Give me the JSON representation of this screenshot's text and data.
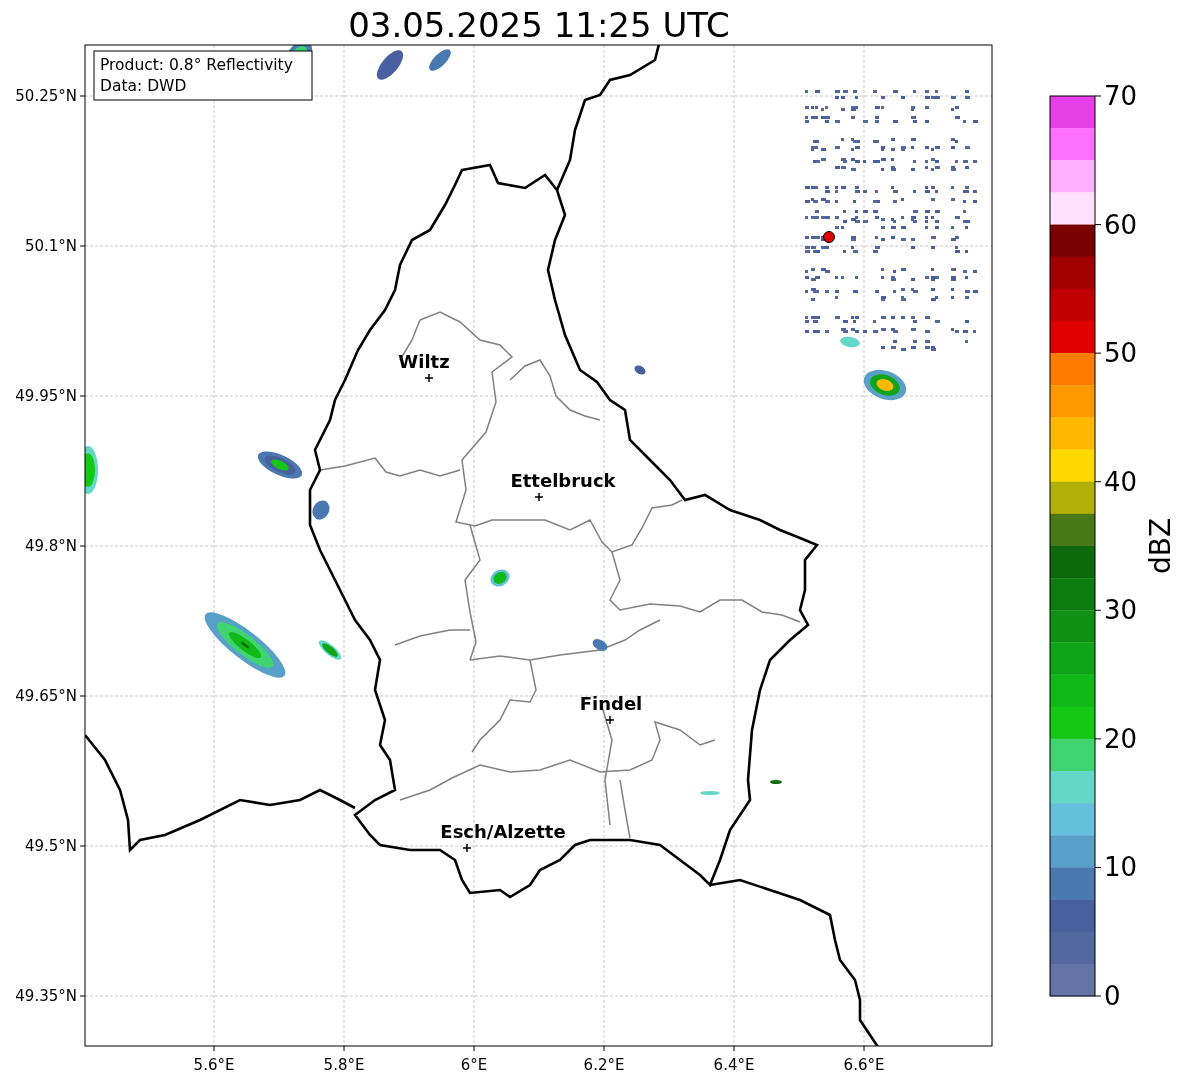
{
  "title": "03.05.2025 11:25 UTC",
  "info_box": [
    "Product: 0.8° Reflectivity",
    "Data: DWD"
  ],
  "map": {
    "lat_ticks": [
      "50.25°N",
      "50.1°N",
      "49.95°N",
      "49.8°N",
      "49.65°N",
      "49.5°N",
      "49.35°N"
    ],
    "lon_ticks": [
      "5.6°E",
      "5.8°E",
      "6°E",
      "6.2°E",
      "6.4°E",
      "6.6°E"
    ],
    "places": [
      {
        "name": "Wiltz"
      },
      {
        "name": "Ettelbruck"
      },
      {
        "name": "Findel"
      },
      {
        "name": "Esch/Alzette"
      }
    ]
  },
  "colorbar": {
    "label": "dBZ",
    "ticks": [
      "70",
      "60",
      "50",
      "40",
      "30",
      "20",
      "10",
      "0"
    ],
    "bins": [
      {
        "color": "#e840e8"
      },
      {
        "color": "#ff70ff"
      },
      {
        "color": "#ffb0ff"
      },
      {
        "color": "#ffe0ff"
      },
      {
        "color": "#780000"
      },
      {
        "color": "#a00000"
      },
      {
        "color": "#c00000"
      },
      {
        "color": "#e00000"
      },
      {
        "color": "#ff7c00"
      },
      {
        "color": "#ff9800"
      },
      {
        "color": "#ffb800"
      },
      {
        "color": "#ffd800"
      },
      {
        "color": "#b0b008"
      },
      {
        "color": "#487818"
      },
      {
        "color": "#0c6a0c"
      },
      {
        "color": "#0c7c10"
      },
      {
        "color": "#109014"
      },
      {
        "color": "#10a418"
      },
      {
        "color": "#10b818"
      },
      {
        "color": "#14c814"
      },
      {
        "color": "#40d470"
      },
      {
        "color": "#64d8c8"
      },
      {
        "color": "#64c0dc"
      },
      {
        "color": "#58a0c8"
      },
      {
        "color": "#4a78b0"
      },
      {
        "color": "#4860a0"
      },
      {
        "color": "#5468a0"
      },
      {
        "color": "#6474a4"
      }
    ]
  }
}
